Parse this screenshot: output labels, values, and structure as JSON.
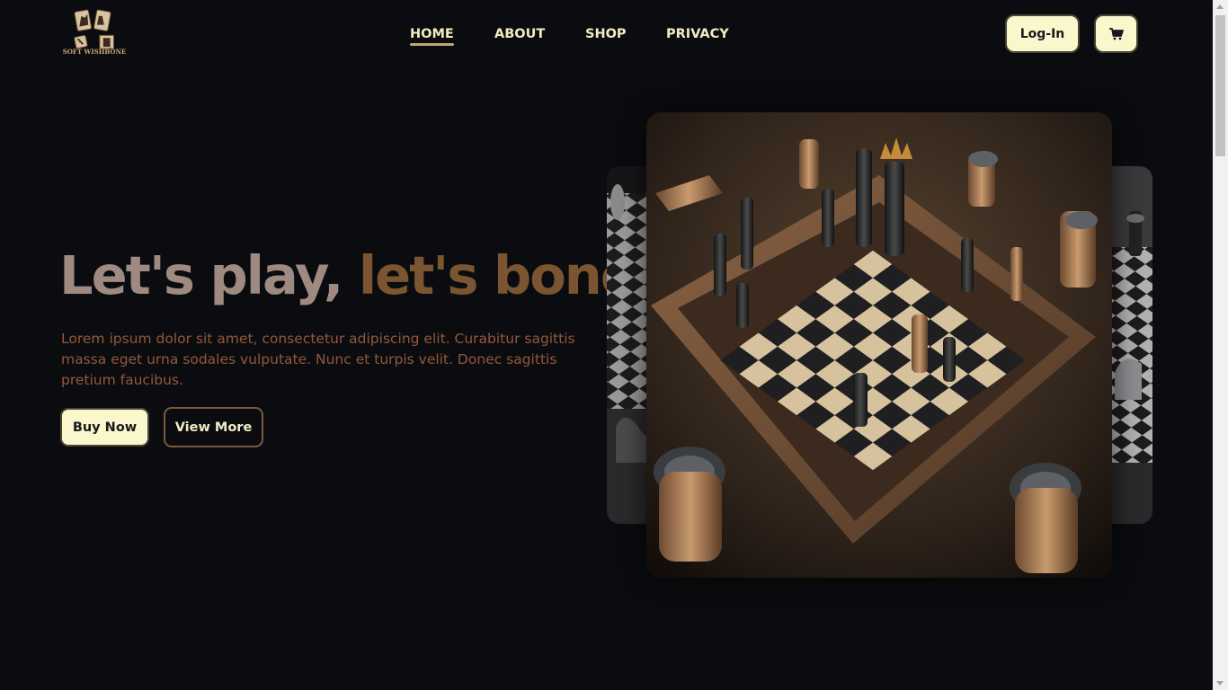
{
  "logo": {
    "text": "SOFT WISHBONE"
  },
  "nav": {
    "items": [
      {
        "label": "HOME",
        "active": true
      },
      {
        "label": "ABOUT",
        "active": false
      },
      {
        "label": "SHOP",
        "active": false
      },
      {
        "label": "PRIVACY",
        "active": false
      }
    ]
  },
  "header": {
    "login_label": "Log-In",
    "cart_icon": "shopping-cart-icon"
  },
  "hero": {
    "headline_part1": "Let's play,",
    "headline_part2": "let's bond.",
    "description": "Lorem ipsum dolor sit amet, consectetur adipiscing elit. Curabitur sagittis massa eget urna sodales vulputate. Nunc et turpis velit. Donec sagittis pretium faucibus.",
    "buy_label": "Buy Now",
    "view_label": "View More"
  },
  "carousel": {
    "main_image": "wooden-chess-board-image",
    "side_images": [
      "silver-chess-board-image-left",
      "silver-chess-board-image-right"
    ]
  },
  "colors": {
    "background": "#0a0c0f",
    "nav_text": "#f2ecc4",
    "button_fill": "#fbf7cd",
    "headline_light": "#9e8a80",
    "headline_dark": "#7b5531",
    "description_text": "#94583b",
    "accent_underline": "#c4a574"
  }
}
